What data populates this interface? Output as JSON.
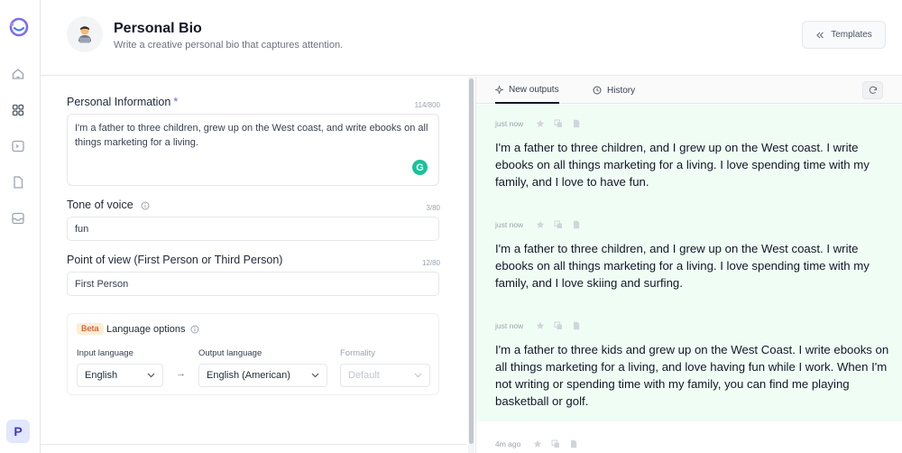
{
  "header": {
    "title": "Personal Bio",
    "subtitle": "Write a creative personal bio that captures attention.",
    "templates_label": "Templates"
  },
  "sidebar": {
    "avatar_letter": "P",
    "items": [
      "home-icon",
      "grid-icon",
      "terminal-icon",
      "document-icon",
      "inbox-icon"
    ]
  },
  "form": {
    "personal_info": {
      "label": "Personal Information",
      "required_mark": "*",
      "counter": "114/800",
      "value": "I'm a father to three children, grew up on the West coast, and write ebooks on all things marketing for a living."
    },
    "tone": {
      "label": "Tone of voice",
      "counter": "3/80",
      "value": "fun"
    },
    "point_of_view": {
      "label": "Point of view (First Person or Third Person)",
      "counter": "12/80",
      "value": "First Person"
    },
    "language": {
      "beta": "Beta",
      "title": "Language options",
      "input_label": "Input language",
      "input_value": "English",
      "output_label": "Output language",
      "output_value": "English (American)",
      "formality_label": "Formality",
      "formality_value": "Default",
      "arrow": "→"
    }
  },
  "outputs": {
    "tabs": [
      {
        "label": "New outputs"
      },
      {
        "label": "History"
      }
    ],
    "items": [
      {
        "time": "just now",
        "text": "I'm a father to three children, and I grew up on the West coast. I write ebooks on all things marketing for a living. I love spending time with my family, and I love to have fun."
      },
      {
        "time": "just now",
        "text": "I'm a father to three children, and I grew up on the West coast. I write ebooks on all things marketing for a living. I love spending time with my family, and I love skiing and surfing."
      },
      {
        "time": "just now",
        "text": "I'm a father to three kids and grew up on the West Coast. I write ebooks on all things marketing for a living, and love having fun while I work. When I'm not writing or spending time with my family, you can find me playing basketball or golf."
      },
      {
        "time": "4m ago"
      }
    ]
  },
  "colors": {
    "accent": "#6366f1",
    "output_bg": "#f0fdf4",
    "grammarly": "#15c39a"
  }
}
